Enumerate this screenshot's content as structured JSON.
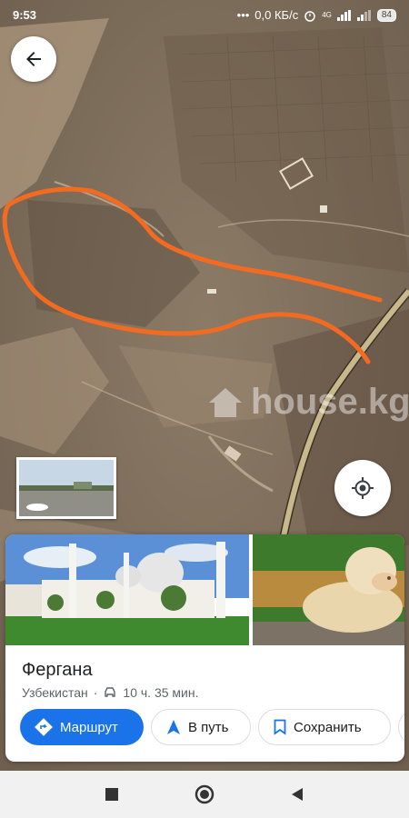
{
  "status_bar": {
    "time": "9:53",
    "network_speed": "0,0 КБ/с",
    "signal": "4G",
    "battery": "84"
  },
  "map": {
    "watermark": "house.kg",
    "route_color": "#f26b21"
  },
  "place_card": {
    "title": "Фергана",
    "subtitle": "Узбекистан",
    "drive_time": "10 ч. 35 мин.",
    "actions": {
      "directions": "Маршрут",
      "start": "В путь",
      "save": "Сохранить"
    }
  },
  "colors": {
    "accent": "#1a73e8"
  },
  "icons": [
    "back-arrow-icon",
    "my-location-icon",
    "car-icon",
    "directions-icon",
    "navigation-icon",
    "bookmark-icon",
    "square-icon",
    "circle-icon",
    "triangle-back-icon"
  ]
}
